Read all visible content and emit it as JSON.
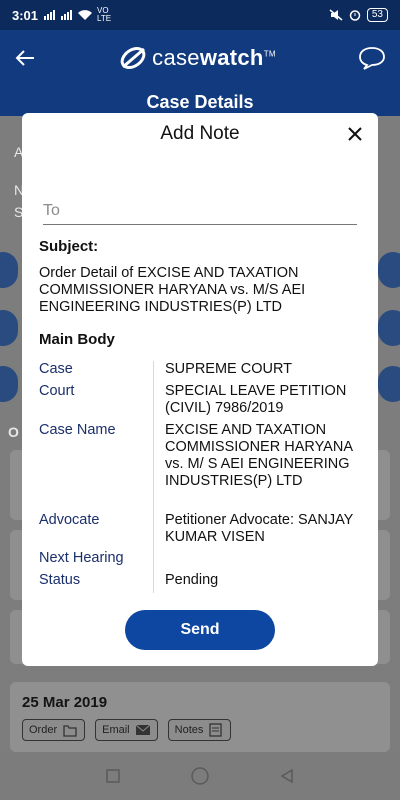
{
  "status_bar": {
    "time": "3:01",
    "network_label": "VO LTE",
    "battery": "53"
  },
  "app": {
    "brand_light": "case",
    "brand_bold": "watch",
    "brand_tm": "TM",
    "page_title": "Case Details"
  },
  "background": {
    "date_card": {
      "date": "25 Mar 2019",
      "chips": [
        "Order",
        "Email",
        "Notes"
      ]
    }
  },
  "modal": {
    "title": "Add Note",
    "to_placeholder": "To",
    "subject_label": "Subject:",
    "subject_text": "Order Detail of EXCISE AND TAXATION COMMISSIONER HARYANA vs. M/S AEI ENGINEERING INDUSTRIES(P) LTD",
    "main_body_label": "Main Body",
    "rows": [
      {
        "key": "Case",
        "value": "SUPREME COURT"
      },
      {
        "key": "Court",
        "value": "SPECIAL LEAVE PETITION (CIVIL) 7986/2019"
      },
      {
        "key": "Case Name",
        "value": "EXCISE AND TAXATION COMMISSIONER HARYANA vs. M/ S AEI ENGINEERING INDUSTRIES(P) LTD"
      },
      {
        "key": "Advocate",
        "value": "Petitioner Advocate: SANJAY KUMAR VISEN"
      },
      {
        "key": "Next Hearing",
        "value": ""
      },
      {
        "key": "Status",
        "value": "Pending"
      }
    ],
    "send_label": "Send"
  },
  "colors": {
    "primary": "#0e47a1",
    "header": "#123a7e",
    "label_blue": "#1b2f6b"
  },
  "icons": [
    "back-arrow-icon",
    "chat-bubble-icon",
    "close-icon",
    "square-nav-icon",
    "circle-nav-icon",
    "triangle-back-nav-icon",
    "pdf-icon",
    "email-icon",
    "notes-icon"
  ]
}
